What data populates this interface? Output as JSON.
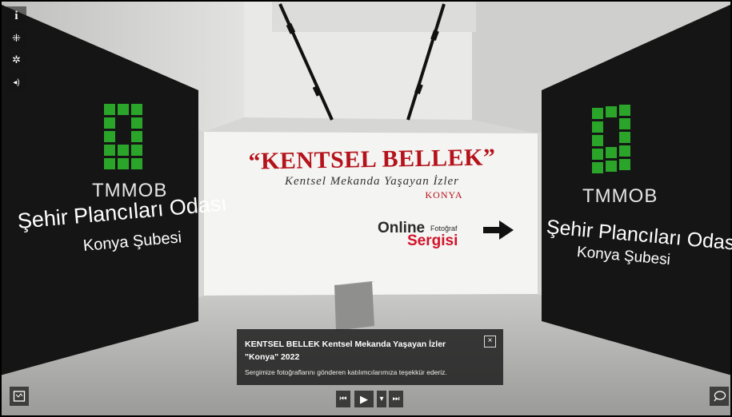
{
  "toolbar": {
    "items": [
      {
        "name": "info-button",
        "glyph": "i"
      },
      {
        "name": "fullscreen-toggle",
        "glyph": "⁜"
      },
      {
        "name": "settings-button",
        "glyph": "✲"
      },
      {
        "name": "sound-toggle",
        "glyph": "◂)"
      }
    ]
  },
  "center_wall": {
    "title": "“KENTSEL BELLEK”",
    "subtitle": "Kentsel Mekanda Yaşayan İzler",
    "city": "KONYA",
    "online": "Online",
    "fotograf": "Fotoğraf",
    "sergisi": "Sergisi"
  },
  "left_panel": {
    "org": "TMMOB",
    "name": "Şehir Plancıları Odası",
    "branch": "Konya Şubesi"
  },
  "right_panel": {
    "org": "TMMOB",
    "name": "Şehir Plancıları Odası",
    "branch": "Konya Şubesi"
  },
  "info_popup": {
    "title_line1": "KENTSEL BELLEK Kentsel Mekanda Yaşayan İzler",
    "title_line2": "\"Konya\" 2022",
    "body": "Sergimize fotoğraflarını gönderen katılımcılarımıza teşekkür ederiz.",
    "close": "×"
  },
  "playback": {
    "prev": "⏮",
    "play": "▶",
    "dropdown": "▾",
    "next": "⏭"
  },
  "colors": {
    "logo_green": "#27a327",
    "title_red": "#b5121b",
    "sergisi_red": "#d3122a"
  }
}
